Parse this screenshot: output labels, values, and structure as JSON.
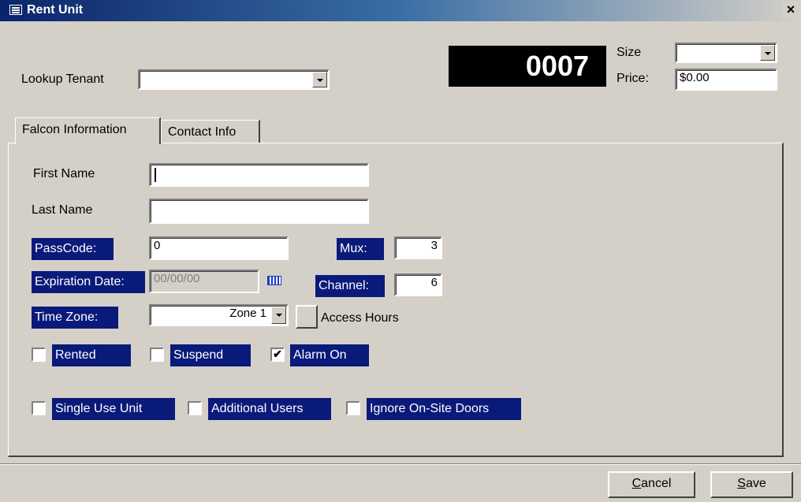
{
  "window": {
    "title": "Rent Unit",
    "close_glyph": "×"
  },
  "header": {
    "lookup_label": "Lookup Tenant",
    "lookup_value": "",
    "unit_number": "0007",
    "size_label": "Size",
    "size_value": "",
    "price_label": "Price:",
    "price_value": "$0.00"
  },
  "tabs": [
    {
      "label": "Falcon Information",
      "active": true
    },
    {
      "label": "Contact Info",
      "active": false
    }
  ],
  "form": {
    "first_name_label": "First Name",
    "first_name_value": "",
    "last_name_label": "Last Name",
    "last_name_value": "",
    "passcode_label": "PassCode:",
    "passcode_value": "0",
    "mux_label": "Mux:",
    "mux_value": "3",
    "expiration_label": "Expiration Date:",
    "expiration_value": "00/00/00",
    "channel_label": "Channel:",
    "channel_value": "6",
    "timezone_label": "Time Zone:",
    "timezone_value": "Zone 1",
    "access_hours_label": "Access Hours",
    "checkboxes": [
      {
        "label": "Rented",
        "checked": false
      },
      {
        "label": "Suspend",
        "checked": false
      },
      {
        "label": "Alarm On",
        "checked": true
      },
      {
        "label": "Single Use Unit",
        "checked": false
      },
      {
        "label": "Additional Users",
        "checked": false
      },
      {
        "label": "Ignore On-Site Doors",
        "checked": false
      }
    ]
  },
  "footer": {
    "cancel_label": "ancel",
    "cancel_mnemonic": "C",
    "save_label": "ave",
    "save_mnemonic": "S"
  },
  "colors": {
    "label_tag_bg": "#0a1a7a",
    "title_bar": "#0a246a",
    "counter_bg": "#000000"
  },
  "icons": [
    "form-icon",
    "close-icon",
    "dropdown-arrow-icon",
    "calendar-icon",
    "check-mark-icon"
  ]
}
